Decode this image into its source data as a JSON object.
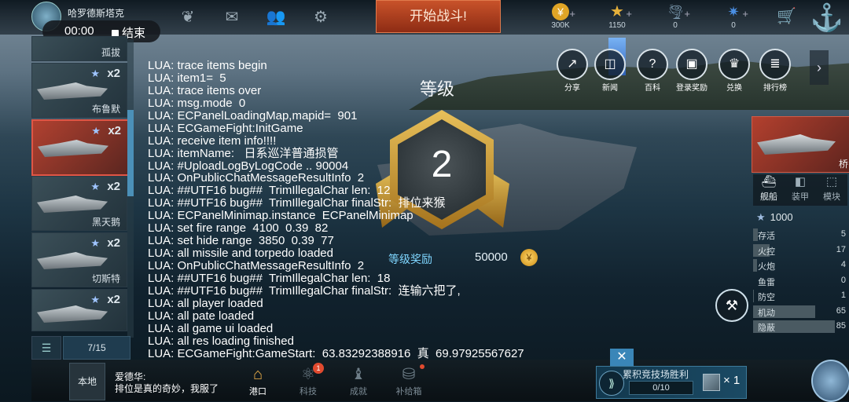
{
  "topbar": {
    "player_name": "哈罗德斯塔克",
    "start_battle": "开始战斗!",
    "resources": [
      {
        "name": "gold-coin-icon",
        "value": "300K",
        "color": "#e0a526"
      },
      {
        "name": "star-medal-icon",
        "value": "1150",
        "color": "#e6b13b"
      },
      {
        "name": "tornado-icon",
        "value": "0",
        "color": "#7d9bb1"
      },
      {
        "name": "blue-gem-icon",
        "value": "0",
        "color": "#4a8fe3"
      }
    ]
  },
  "recorder": {
    "time": "00:00",
    "stop_label": "结束"
  },
  "ship_list": {
    "items": [
      {
        "name": "孤拔",
        "count": ""
      },
      {
        "name": "布鲁默",
        "count": "x2"
      },
      {
        "name": "",
        "count": "x2",
        "selected": true
      },
      {
        "name": "黑天鹅",
        "count": "x2"
      },
      {
        "name": "切斯特",
        "count": "x2"
      },
      {
        "name": "",
        "count": "x2"
      }
    ],
    "page": "7/15"
  },
  "level_panel": {
    "title": "等级",
    "level": "2",
    "reward_label": "等级奖励",
    "reward_value": "50000"
  },
  "actions": [
    {
      "label": "分享",
      "icon": "share-icon"
    },
    {
      "label": "新闻",
      "icon": "news-icon"
    },
    {
      "label": "百科",
      "icon": "encyclopedia-icon"
    },
    {
      "label": "登录奖励",
      "icon": "login-reward-icon"
    },
    {
      "label": "兑换",
      "icon": "exchange-icon"
    },
    {
      "label": "排行榜",
      "icon": "leaderboard-icon"
    }
  ],
  "right_panel": {
    "ship_name": "桥",
    "tabs": [
      {
        "label": "舰船",
        "icon": "ship-icon",
        "active": true
      },
      {
        "label": "装甲",
        "icon": "armor-icon",
        "active": false
      },
      {
        "label": "模块",
        "icon": "module-icon",
        "active": false
      }
    ],
    "star_value": "1000",
    "stats": [
      {
        "label": "存活",
        "value": "5",
        "level": 0.05
      },
      {
        "label": "火控",
        "value": "17",
        "level": 0.17
      },
      {
        "label": "火炮",
        "value": "4",
        "level": 0.04
      },
      {
        "label": "鱼雷",
        "value": "0",
        "level": 0.0
      },
      {
        "label": "防空",
        "value": "1",
        "level": 0.01
      },
      {
        "label": "机动",
        "value": "65",
        "level": 0.65
      },
      {
        "label": "隐蔽",
        "value": "85",
        "level": 0.85
      }
    ]
  },
  "log_lines": [
    "LUA: trace items begin",
    "LUA: item1=  5",
    "LUA: trace items over",
    "LUA: msg.mode  0",
    "LUA: ECPanelLoadingMap,mapid=  901",
    "LUA: ECGameFight:InitGame",
    "LUA: receive item info!!!!",
    "LUA: itemName:   日系巡洋普通损管",
    "LUA: #UploadLogByLogCode .. 90004",
    "LUA: OnPublicChatMessageResultInfo  2",
    "LUA: ##UTF16 bug##  TrimIllegalChar len:  12",
    "LUA: ##UTF16 bug##  TrimIllegalChar finalStr:  排位来猴",
    "LUA: ECPanelMinimap.instance  ECPanelMinimap",
    "LUA: set fire range  4100  0.39  82",
    "LUA: set hide range  3850  0.39  77",
    "LUA: all missile and torpedo loaded",
    "LUA: OnPublicChatMessageResultInfo  2",
    "LUA: ##UTF16 bug##  TrimIllegalChar len:  18",
    "LUA: ##UTF16 bug##  TrimIllegalChar finalStr:  连输六把了,",
    "LUA: all player loaded",
    "LUA: all pate loaded",
    "LUA: all game ui loaded",
    "LUA: all res loading finished",
    "LUA: ECGameFight:GameStart:  63.83292388916  真  69.97925567627"
  ],
  "chat": {
    "channel": "本地",
    "user": "爱德华:",
    "message": "排位是真的奇妙，我服了"
  },
  "nav": [
    {
      "label": "港口",
      "icon": "harbor-icon",
      "active": true,
      "badge": ""
    },
    {
      "label": "科技",
      "icon": "tech-icon",
      "active": false,
      "badge": "1"
    },
    {
      "label": "成就",
      "icon": "achievement-icon",
      "active": false,
      "badge": ""
    },
    {
      "label": "补给箱",
      "icon": "supply-box-icon",
      "active": false,
      "badge": "dot"
    }
  ],
  "arena": {
    "title": "累积竞技场胜利",
    "progress": "0/10",
    "progress_level": 0.0,
    "quantity": "× 1"
  }
}
